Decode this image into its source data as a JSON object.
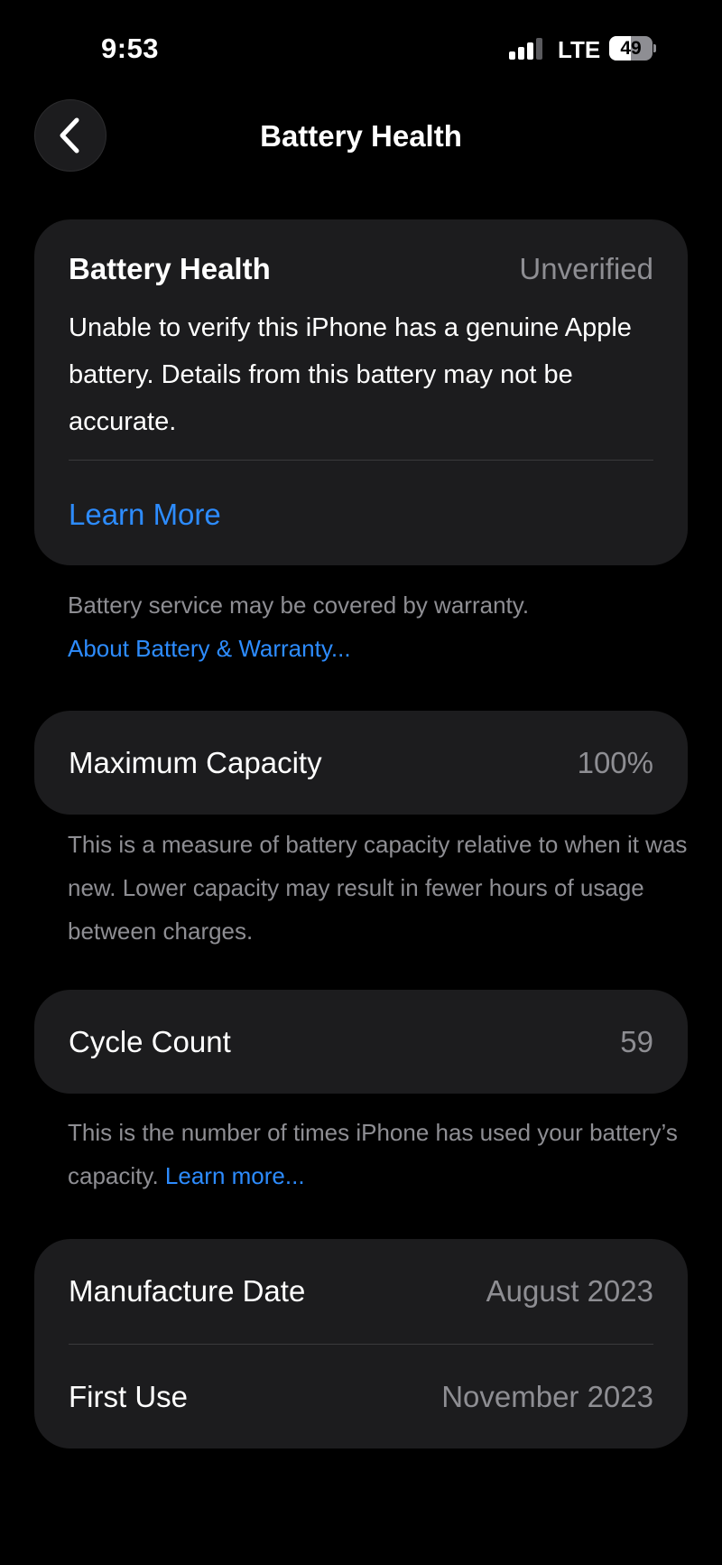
{
  "status_bar": {
    "time": "9:53",
    "network": "LTE",
    "battery_percent": "49",
    "battery_level": 0.49
  },
  "nav": {
    "back_icon": "chevron-left-icon",
    "title": "Battery Health"
  },
  "health_card": {
    "label": "Battery Health",
    "value": "Unverified",
    "description": "Unable to verify this iPhone has a genuine Apple battery. Details from this battery may not be accurate.",
    "learn_more": "Learn More"
  },
  "warranty_note": {
    "text": "Battery service may be covered by warranty.",
    "link": "About Battery & Warranty..."
  },
  "capacity": {
    "label": "Maximum Capacity",
    "value": "100%",
    "footnote": "This is a measure of battery capacity relative to when it was new. Lower capacity may result in fewer hours of usage between charges."
  },
  "cycle": {
    "label": "Cycle Count",
    "value": "59",
    "footnote": "This is the number of times iPhone has used your battery’s capacity.",
    "footnote_link": "Learn more..."
  },
  "dates": {
    "manufacture_label": "Manufacture Date",
    "manufacture_value": "August 2023",
    "first_use_label": "First Use",
    "first_use_value": "November 2023"
  },
  "colors": {
    "background": "#000000",
    "card": "#1c1c1e",
    "accent": "#2d8cff",
    "secondary_text": "#8e8e93"
  }
}
